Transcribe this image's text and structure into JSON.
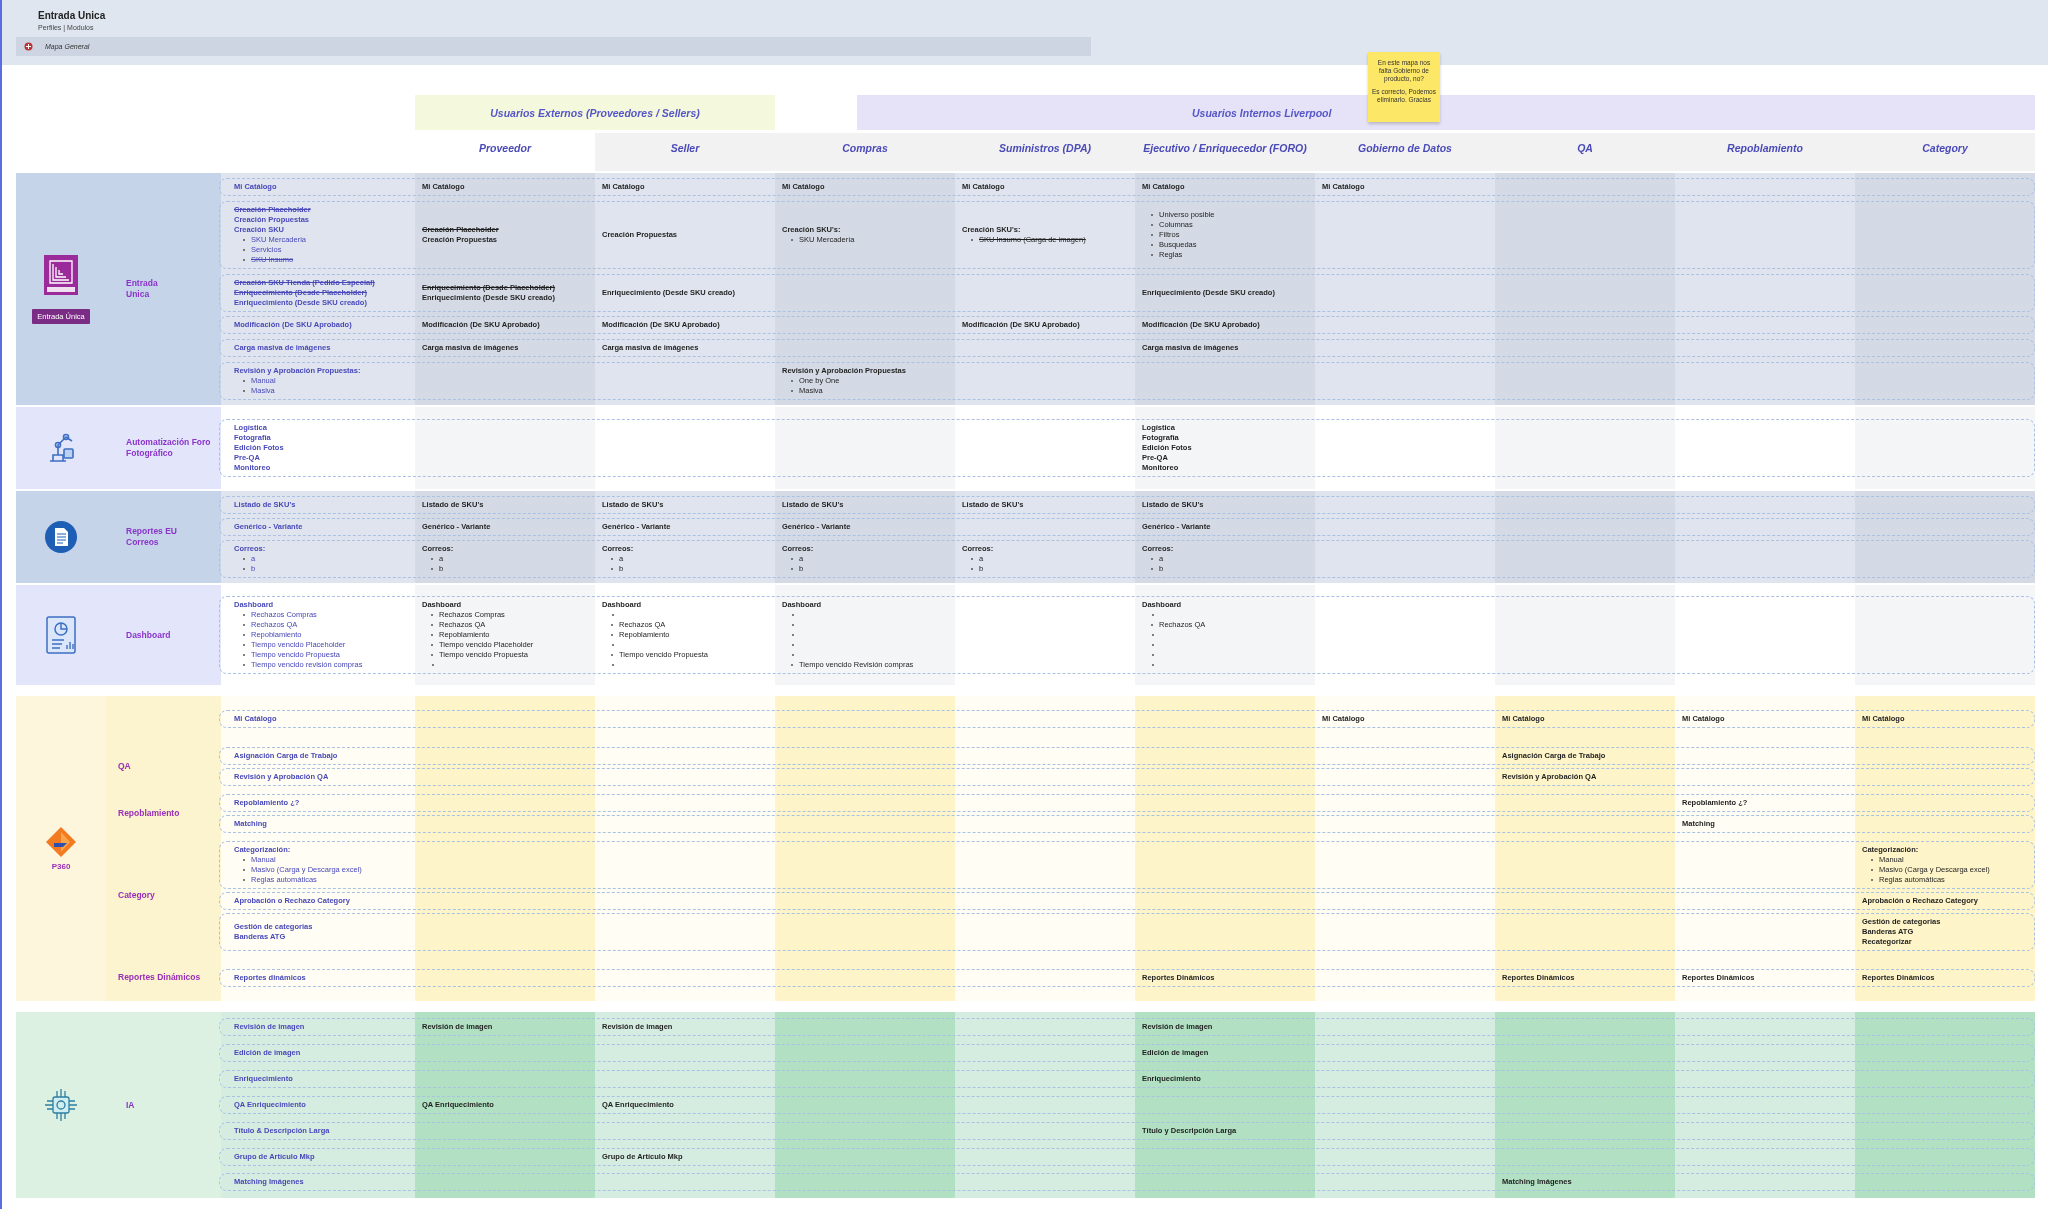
{
  "header": {
    "title": "Entrada Unica",
    "subtitle": "Perfiles | Modulos",
    "map_label": "Mapa General"
  },
  "sticky_note": {
    "lines": [
      "En este mapa nos falta Gobierno de producto, no?",
      "Es correcto, Podemos eliminarlo. Gracias"
    ]
  },
  "user_groups": [
    {
      "kind": "external",
      "label": "Usuarios Externos (Proveedores / Sellers)"
    },
    {
      "kind": "internal",
      "label": "Usuarios Internos Liverpool"
    }
  ],
  "roles": [
    "Proveedor",
    "Seller",
    "Compras",
    "Suministros (DPA)",
    "Ejecutivo / Enriquecedor (FORO)",
    "Gobierno de Datos",
    "QA",
    "Repoblamiento",
    "Category"
  ],
  "sections": [
    {
      "kind": "entrada",
      "badge": "Entrada Única",
      "groups": [
        {
          "label": "Entrada Unica",
          "rows": [
            {
              "feature": [
                {
                  "kind": "title",
                  "text": "Mi Catálogo"
                }
              ],
              "cells": [
                [
                  {
                    "kind": "title",
                    "text": "Mi Catálogo"
                  }
                ],
                [
                  {
                    "kind": "title",
                    "text": "Mi Catálogo"
                  }
                ],
                [
                  {
                    "kind": "title",
                    "text": "Mi Catálogo"
                  }
                ],
                [
                  {
                    "kind": "title",
                    "text": "Mi Catálogo"
                  }
                ],
                [
                  {
                    "kind": "title",
                    "text": "Mi Catálogo"
                  }
                ],
                [
                  {
                    "kind": "title",
                    "text": "Mi Catálogo"
                  }
                ],
                null,
                null,
                null
              ]
            },
            {
              "feature": [
                {
                  "kind": "struck-title",
                  "text": "Creación Placeholder"
                },
                {
                  "kind": "title",
                  "text": "Creación Propuestas"
                },
                {
                  "kind": "title",
                  "text": "Creación SKU"
                },
                {
                  "kind": "bullet",
                  "text": "SKU Mercaderia"
                },
                {
                  "kind": "bullet",
                  "text": "Servicios"
                },
                {
                  "kind": "struck-bullet",
                  "text": "SKU Insumo"
                }
              ],
              "cells": [
                [
                  {
                    "kind": "struck-title",
                    "text": "Creación Placeholder"
                  },
                  {
                    "kind": "title",
                    "text": "Creación Propuestas"
                  }
                ],
                [
                  {
                    "kind": "title",
                    "text": "Creación Propuestas"
                  }
                ],
                [
                  {
                    "kind": "title",
                    "text": "Creación SKU's:"
                  },
                  {
                    "kind": "bullet",
                    "text": "SKU Mercadería"
                  }
                ],
                [
                  {
                    "kind": "title",
                    "text": "Creación SKU's:"
                  },
                  {
                    "kind": "struck-bullet",
                    "text": "SKU Insumo  (Carga de imagen)"
                  }
                ],
                [
                  {
                    "kind": "bullet",
                    "text": "Universo posible"
                  },
                  {
                    "kind": "bullet",
                    "text": "Columnas"
                  },
                  {
                    "kind": "bullet",
                    "text": "Filtros"
                  },
                  {
                    "kind": "bullet",
                    "text": "Busquedas"
                  },
                  {
                    "kind": "bullet",
                    "text": "Reglas"
                  }
                ],
                null,
                null,
                null,
                null
              ]
            },
            {
              "feature": [
                {
                  "kind": "struck-title",
                  "text": "Creación SKU Tienda (Pedido Especial)"
                },
                {
                  "kind": "struck-title",
                  "text": "Enriquecimiento (Desde Placeholder)"
                },
                {
                  "kind": "title",
                  "text": "Enriquecimiento (Desde SKU creado)"
                }
              ],
              "cells": [
                [
                  {
                    "kind": "struck-title",
                    "text": "Enriquecimiento (Desde Placeholder)"
                  },
                  {
                    "kind": "title",
                    "text": "Enriquecimiento (Desde SKU creado)"
                  }
                ],
                [
                  {
                    "kind": "title",
                    "text": "Enriquecimiento (Desde SKU creado)"
                  }
                ],
                null,
                null,
                [
                  {
                    "kind": "title",
                    "text": "Enriquecimiento (Desde SKU creado)"
                  }
                ],
                null,
                null,
                null,
                null
              ]
            },
            {
              "feature": [
                {
                  "kind": "title",
                  "text": "Modificación (De SKU Aprobado)"
                }
              ],
              "cells": [
                [
                  {
                    "kind": "title",
                    "text": "Modificación (De SKU Aprobado)"
                  }
                ],
                [
                  {
                    "kind": "title",
                    "text": "Modificación (De SKU Aprobado)"
                  }
                ],
                null,
                [
                  {
                    "kind": "title",
                    "text": "Modificación (De SKU Aprobado)"
                  }
                ],
                [
                  {
                    "kind": "title",
                    "text": "Modificación (De SKU Aprobado)"
                  }
                ],
                null,
                null,
                null,
                null
              ]
            },
            {
              "feature": [
                {
                  "kind": "title",
                  "text": "Carga masiva de imágenes"
                }
              ],
              "cells": [
                [
                  {
                    "kind": "title",
                    "text": "Carga masiva de imágenes"
                  }
                ],
                [
                  {
                    "kind": "title",
                    "text": "Carga masiva de imágenes"
                  }
                ],
                null,
                null,
                [
                  {
                    "kind": "title",
                    "text": "Carga masiva de imágenes"
                  }
                ],
                null,
                null,
                null,
                null
              ]
            },
            {
              "feature": [
                {
                  "kind": "title",
                  "text": "Revisión y Aprobación Propuestas:"
                },
                {
                  "kind": "bullet",
                  "text": "Manual"
                },
                {
                  "kind": "bullet",
                  "text": "Masiva"
                }
              ],
              "cells": [
                null,
                null,
                [
                  {
                    "kind": "title",
                    "text": "Revisión y Aprobación Propuestas"
                  },
                  {
                    "kind": "bullet",
                    "text": "One by One"
                  },
                  {
                    "kind": "bullet",
                    "text": "Masiva"
                  }
                ],
                null,
                null,
                null,
                null,
                null,
                null
              ]
            }
          ]
        }
      ]
    },
    {
      "kind": "automation",
      "groups": [
        {
          "label": "Automatización Foro Fotográfico",
          "rows": [
            {
              "feature": [
                {
                  "kind": "title",
                  "text": "Logística"
                },
                {
                  "kind": "title",
                  "text": "Fotografía"
                },
                {
                  "kind": "title",
                  "text": "Edición Fotos"
                },
                {
                  "kind": "title",
                  "text": "Pre-QA"
                },
                {
                  "kind": "title",
                  "text": "Monitoreo"
                }
              ],
              "cells": [
                null,
                null,
                null,
                null,
                [
                  {
                    "kind": "title",
                    "text": "Logística"
                  },
                  {
                    "kind": "title",
                    "text": "Fotografía"
                  },
                  {
                    "kind": "title",
                    "text": "Edición Fotos"
                  },
                  {
                    "kind": "title",
                    "text": "Pre-QA"
                  },
                  {
                    "kind": "title",
                    "text": "Monitoreo"
                  }
                ],
                null,
                null,
                null,
                null
              ]
            }
          ]
        }
      ]
    },
    {
      "kind": "reports",
      "groups": [
        {
          "label": "Reportes EU Correos",
          "rows": [
            {
              "feature": [
                {
                  "kind": "title",
                  "text": "Listado de SKU's"
                }
              ],
              "cells": [
                [
                  {
                    "kind": "title",
                    "text": "Listado de SKU's"
                  }
                ],
                [
                  {
                    "kind": "title",
                    "text": "Listado de SKU's"
                  }
                ],
                [
                  {
                    "kind": "title",
                    "text": "Listado de SKU's"
                  }
                ],
                [
                  {
                    "kind": "title",
                    "text": "Listado de SKU's"
                  }
                ],
                [
                  {
                    "kind": "title",
                    "text": "Listado de SKU's"
                  }
                ],
                null,
                null,
                null,
                null
              ]
            },
            {
              "feature": [
                {
                  "kind": "title",
                  "text": "Genérico - Variante"
                }
              ],
              "cells": [
                [
                  {
                    "kind": "title",
                    "text": "Genérico - Variante"
                  }
                ],
                [
                  {
                    "kind": "title",
                    "text": "Genérico - Variante"
                  }
                ],
                [
                  {
                    "kind": "title",
                    "text": "Genérico - Variante"
                  }
                ],
                null,
                [
                  {
                    "kind": "title",
                    "text": "Genérico - Variante"
                  }
                ],
                null,
                null,
                null,
                null
              ]
            },
            {
              "feature": [
                {
                  "kind": "title",
                  "text": "Correos:"
                },
                {
                  "kind": "bullet",
                  "text": "a"
                },
                {
                  "kind": "bullet",
                  "text": "b"
                }
              ],
              "cells": [
                [
                  {
                    "kind": "title",
                    "text": "Correos:"
                  },
                  {
                    "kind": "bullet",
                    "text": "a"
                  },
                  {
                    "kind": "bullet",
                    "text": "b"
                  }
                ],
                [
                  {
                    "kind": "title",
                    "text": "Correos:"
                  },
                  {
                    "kind": "bullet",
                    "text": "a"
                  },
                  {
                    "kind": "bullet",
                    "text": "b"
                  }
                ],
                [
                  {
                    "kind": "title",
                    "text": "Correos:"
                  },
                  {
                    "kind": "bullet",
                    "text": "a"
                  },
                  {
                    "kind": "bullet",
                    "text": "b"
                  }
                ],
                [
                  {
                    "kind": "title",
                    "text": "Correos:"
                  },
                  {
                    "kind": "bullet",
                    "text": "a"
                  },
                  {
                    "kind": "bullet",
                    "text": "b"
                  }
                ],
                [
                  {
                    "kind": "title",
                    "text": "Correos:"
                  },
                  {
                    "kind": "bullet",
                    "text": "a"
                  },
                  {
                    "kind": "bullet",
                    "text": "b"
                  }
                ],
                null,
                null,
                null,
                null
              ]
            }
          ]
        }
      ]
    },
    {
      "kind": "dashboard",
      "groups": [
        {
          "label": "Dashboard",
          "rows": [
            {
              "feature": [
                {
                  "kind": "title",
                  "text": "Dashboard"
                },
                {
                  "kind": "bullet",
                  "text": "Rechazos Compras"
                },
                {
                  "kind": "bullet",
                  "text": "Rechazos QA"
                },
                {
                  "kind": "bullet",
                  "text": "Repoblamiento"
                },
                {
                  "kind": "bullet",
                  "text": "Tiempo vencido Placeholder"
                },
                {
                  "kind": "bullet",
                  "text": "Tiempo vencido Propuesta"
                },
                {
                  "kind": "bullet",
                  "text": "Tiempo vencido revisión compras"
                }
              ],
              "cells": [
                [
                  {
                    "kind": "title",
                    "text": "Dashboard"
                  },
                  {
                    "kind": "bullet",
                    "text": "Rechazos Compras"
                  },
                  {
                    "kind": "bullet",
                    "text": "Rechazos QA"
                  },
                  {
                    "kind": "bullet",
                    "text": "Repoblamiento"
                  },
                  {
                    "kind": "bullet",
                    "text": "Tiempo vencido Placeholder"
                  },
                  {
                    "kind": "bullet",
                    "text": "Tiempo vencido Propuesta"
                  },
                  {
                    "kind": "blank"
                  }
                ],
                [
                  {
                    "kind": "title",
                    "text": "Dashboard"
                  },
                  {
                    "kind": "blank"
                  },
                  {
                    "kind": "bullet",
                    "text": "Rechazos QA"
                  },
                  {
                    "kind": "bullet",
                    "text": "Repoblamiento"
                  },
                  {
                    "kind": "blank"
                  },
                  {
                    "kind": "bullet",
                    "text": "Tiempo vencido Propuesta"
                  },
                  {
                    "kind": "blank"
                  }
                ],
                [
                  {
                    "kind": "title",
                    "text": "Dashboard"
                  },
                  {
                    "kind": "blank"
                  },
                  {
                    "kind": "blank"
                  },
                  {
                    "kind": "blank"
                  },
                  {
                    "kind": "blank"
                  },
                  {
                    "kind": "blank"
                  },
                  {
                    "kind": "bullet",
                    "text": "Tiempo vencido Revisión compras"
                  }
                ],
                null,
                [
                  {
                    "kind": "title",
                    "text": "Dashboard"
                  },
                  {
                    "kind": "blank"
                  },
                  {
                    "kind": "bullet",
                    "text": "Rechazos QA"
                  },
                  {
                    "kind": "blank"
                  },
                  {
                    "kind": "blank"
                  },
                  {
                    "kind": "blank"
                  },
                  {
                    "kind": "blank"
                  }
                ],
                null,
                null,
                null,
                null
              ]
            }
          ]
        }
      ]
    },
    {
      "kind": "p360",
      "caption": "P360",
      "groups": [
        {
          "rows": [
            {
              "feature": [
                {
                  "kind": "title",
                  "text": "Mi Catálogo"
                }
              ],
              "cells": [
                null,
                null,
                null,
                null,
                null,
                [
                  {
                    "kind": "title",
                    "text": "Mi Catálogo"
                  }
                ],
                [
                  {
                    "kind": "title",
                    "text": "Mi Catálogo"
                  }
                ],
                [
                  {
                    "kind": "title",
                    "text": "Mi Catálogo"
                  }
                ],
                [
                  {
                    "kind": "title",
                    "text": "Mi Catálogo"
                  }
                ]
              ]
            }
          ]
        },
        {
          "label": "QA",
          "rows": [
            {
              "feature": [
                {
                  "kind": "title",
                  "text": "Asignación Carga de Trabajo"
                }
              ],
              "cells": [
                null,
                null,
                null,
                null,
                null,
                null,
                [
                  {
                    "kind": "title",
                    "text": "Asignación Carga de Trabajo"
                  }
                ],
                null,
                null
              ]
            },
            {
              "feature": [
                {
                  "kind": "title",
                  "text": "Revisión y Aprobación QA"
                }
              ],
              "cells": [
                null,
                null,
                null,
                null,
                null,
                null,
                [
                  {
                    "kind": "title",
                    "text": "Revisión y Aprobación QA"
                  }
                ],
                null,
                null
              ]
            }
          ]
        },
        {
          "label": "Repoblamiento",
          "rows": [
            {
              "feature": [
                {
                  "kind": "title",
                  "text": "Repoblamiento ¿?"
                }
              ],
              "cells": [
                null,
                null,
                null,
                null,
                null,
                null,
                null,
                [
                  {
                    "kind": "title",
                    "text": "Repoblamiento ¿?"
                  }
                ],
                null
              ]
            },
            {
              "feature": [
                {
                  "kind": "title",
                  "text": "Matching"
                }
              ],
              "cells": [
                null,
                null,
                null,
                null,
                null,
                null,
                null,
                [
                  {
                    "kind": "title",
                    "text": "Matching"
                  }
                ],
                null
              ]
            }
          ]
        },
        {
          "label": "Category",
          "rows": [
            {
              "feature": [
                {
                  "kind": "title",
                  "text": "Categorización:"
                },
                {
                  "kind": "bullet",
                  "text": "Manual"
                },
                {
                  "kind": "bullet",
                  "text": "Masivo (Carga y Descarga excel)"
                },
                {
                  "kind": "bullet",
                  "text": "Reglas automáticas"
                }
              ],
              "cells": [
                null,
                null,
                null,
                null,
                null,
                null,
                null,
                null,
                [
                  {
                    "kind": "title",
                    "text": "Categorización:"
                  },
                  {
                    "kind": "bullet",
                    "text": "Manual"
                  },
                  {
                    "kind": "bullet",
                    "text": "Masivo (Carga y Descarga excel)"
                  },
                  {
                    "kind": "bullet",
                    "text": "Reglas automáticas"
                  }
                ]
              ]
            },
            {
              "feature": [
                {
                  "kind": "title",
                  "text": "Aprobación o Rechazo Category"
                }
              ],
              "cells": [
                null,
                null,
                null,
                null,
                null,
                null,
                null,
                null,
                [
                  {
                    "kind": "title",
                    "text": "Aprobación o Rechazo Category"
                  }
                ]
              ]
            },
            {
              "feature": [
                {
                  "kind": "title",
                  "text": "Gestión de categorias"
                },
                {
                  "kind": "title",
                  "text": "Banderas ATG"
                }
              ],
              "cells": [
                null,
                null,
                null,
                null,
                null,
                null,
                null,
                null,
                [
                  {
                    "kind": "title",
                    "text": "Gestión de categorias"
                  },
                  {
                    "kind": "title",
                    "text": "Banderas ATG"
                  },
                  {
                    "kind": "title",
                    "text": "Recategorizar"
                  }
                ]
              ]
            }
          ]
        },
        {
          "label": "Reportes Dinámicos",
          "rows": [
            {
              "feature": [
                {
                  "kind": "title",
                  "text": "Reportes dinámicos"
                }
              ],
              "cells": [
                null,
                null,
                null,
                null,
                [
                  {
                    "kind": "title",
                    "text": "Reportes Dinámicos"
                  }
                ],
                null,
                [
                  {
                    "kind": "title",
                    "text": "Reportes Dinámicos"
                  }
                ],
                [
                  {
                    "kind": "title",
                    "text": "Reportes Dinámicos"
                  }
                ],
                [
                  {
                    "kind": "title",
                    "text": "Reportes Dinámicos"
                  }
                ]
              ]
            }
          ]
        }
      ]
    },
    {
      "kind": "ia",
      "groups": [
        {
          "label": "IA",
          "rows": [
            {
              "feature": [
                {
                  "kind": "title",
                  "text": "Revisión de imagen"
                }
              ],
              "cells": [
                [
                  {
                    "kind": "title",
                    "text": "Revisión de imagen"
                  }
                ],
                [
                  {
                    "kind": "title",
                    "text": "Revisión de imagen"
                  }
                ],
                null,
                null,
                [
                  {
                    "kind": "title",
                    "text": "Revisión de imagen"
                  }
                ],
                null,
                null,
                null,
                null
              ]
            },
            {
              "feature": [
                {
                  "kind": "title",
                  "text": "Edición de imagen"
                }
              ],
              "cells": [
                null,
                null,
                null,
                null,
                [
                  {
                    "kind": "title",
                    "text": "Edición de imagen"
                  }
                ],
                null,
                null,
                null,
                null
              ]
            },
            {
              "feature": [
                {
                  "kind": "title",
                  "text": "Enriquecimiento"
                }
              ],
              "cells": [
                null,
                null,
                null,
                null,
                [
                  {
                    "kind": "title",
                    "text": "Enriquecimiento"
                  }
                ],
                null,
                null,
                null,
                null
              ]
            },
            {
              "feature": [
                {
                  "kind": "title",
                  "text": "QA Enriquecimiento"
                }
              ],
              "cells": [
                [
                  {
                    "kind": "title",
                    "text": "QA Enriquecimiento"
                  }
                ],
                [
                  {
                    "kind": "title",
                    "text": "QA Enriquecimiento"
                  }
                ],
                null,
                null,
                null,
                null,
                null,
                null,
                null
              ]
            },
            {
              "feature": [
                {
                  "kind": "title",
                  "text": "Título & Descripción Larga"
                }
              ],
              "cells": [
                null,
                null,
                null,
                null,
                [
                  {
                    "kind": "title",
                    "text": "Título y Descripción Larga"
                  }
                ],
                null,
                null,
                null,
                null
              ]
            },
            {
              "feature": [
                {
                  "kind": "title",
                  "text": "Grupo de Artículo Mkp"
                }
              ],
              "cells": [
                null,
                [
                  {
                    "kind": "title",
                    "text": "Grupo de Artículo Mkp"
                  }
                ],
                null,
                null,
                null,
                null,
                null,
                null,
                null
              ]
            },
            {
              "feature": [
                {
                  "kind": "title",
                  "text": "Matching Imágenes"
                }
              ],
              "cells": [
                null,
                null,
                null,
                null,
                null,
                null,
                [
                  {
                    "kind": "title",
                    "text": "Matching Imágenes"
                  }
                ],
                null,
                null
              ]
            }
          ]
        }
      ]
    }
  ]
}
